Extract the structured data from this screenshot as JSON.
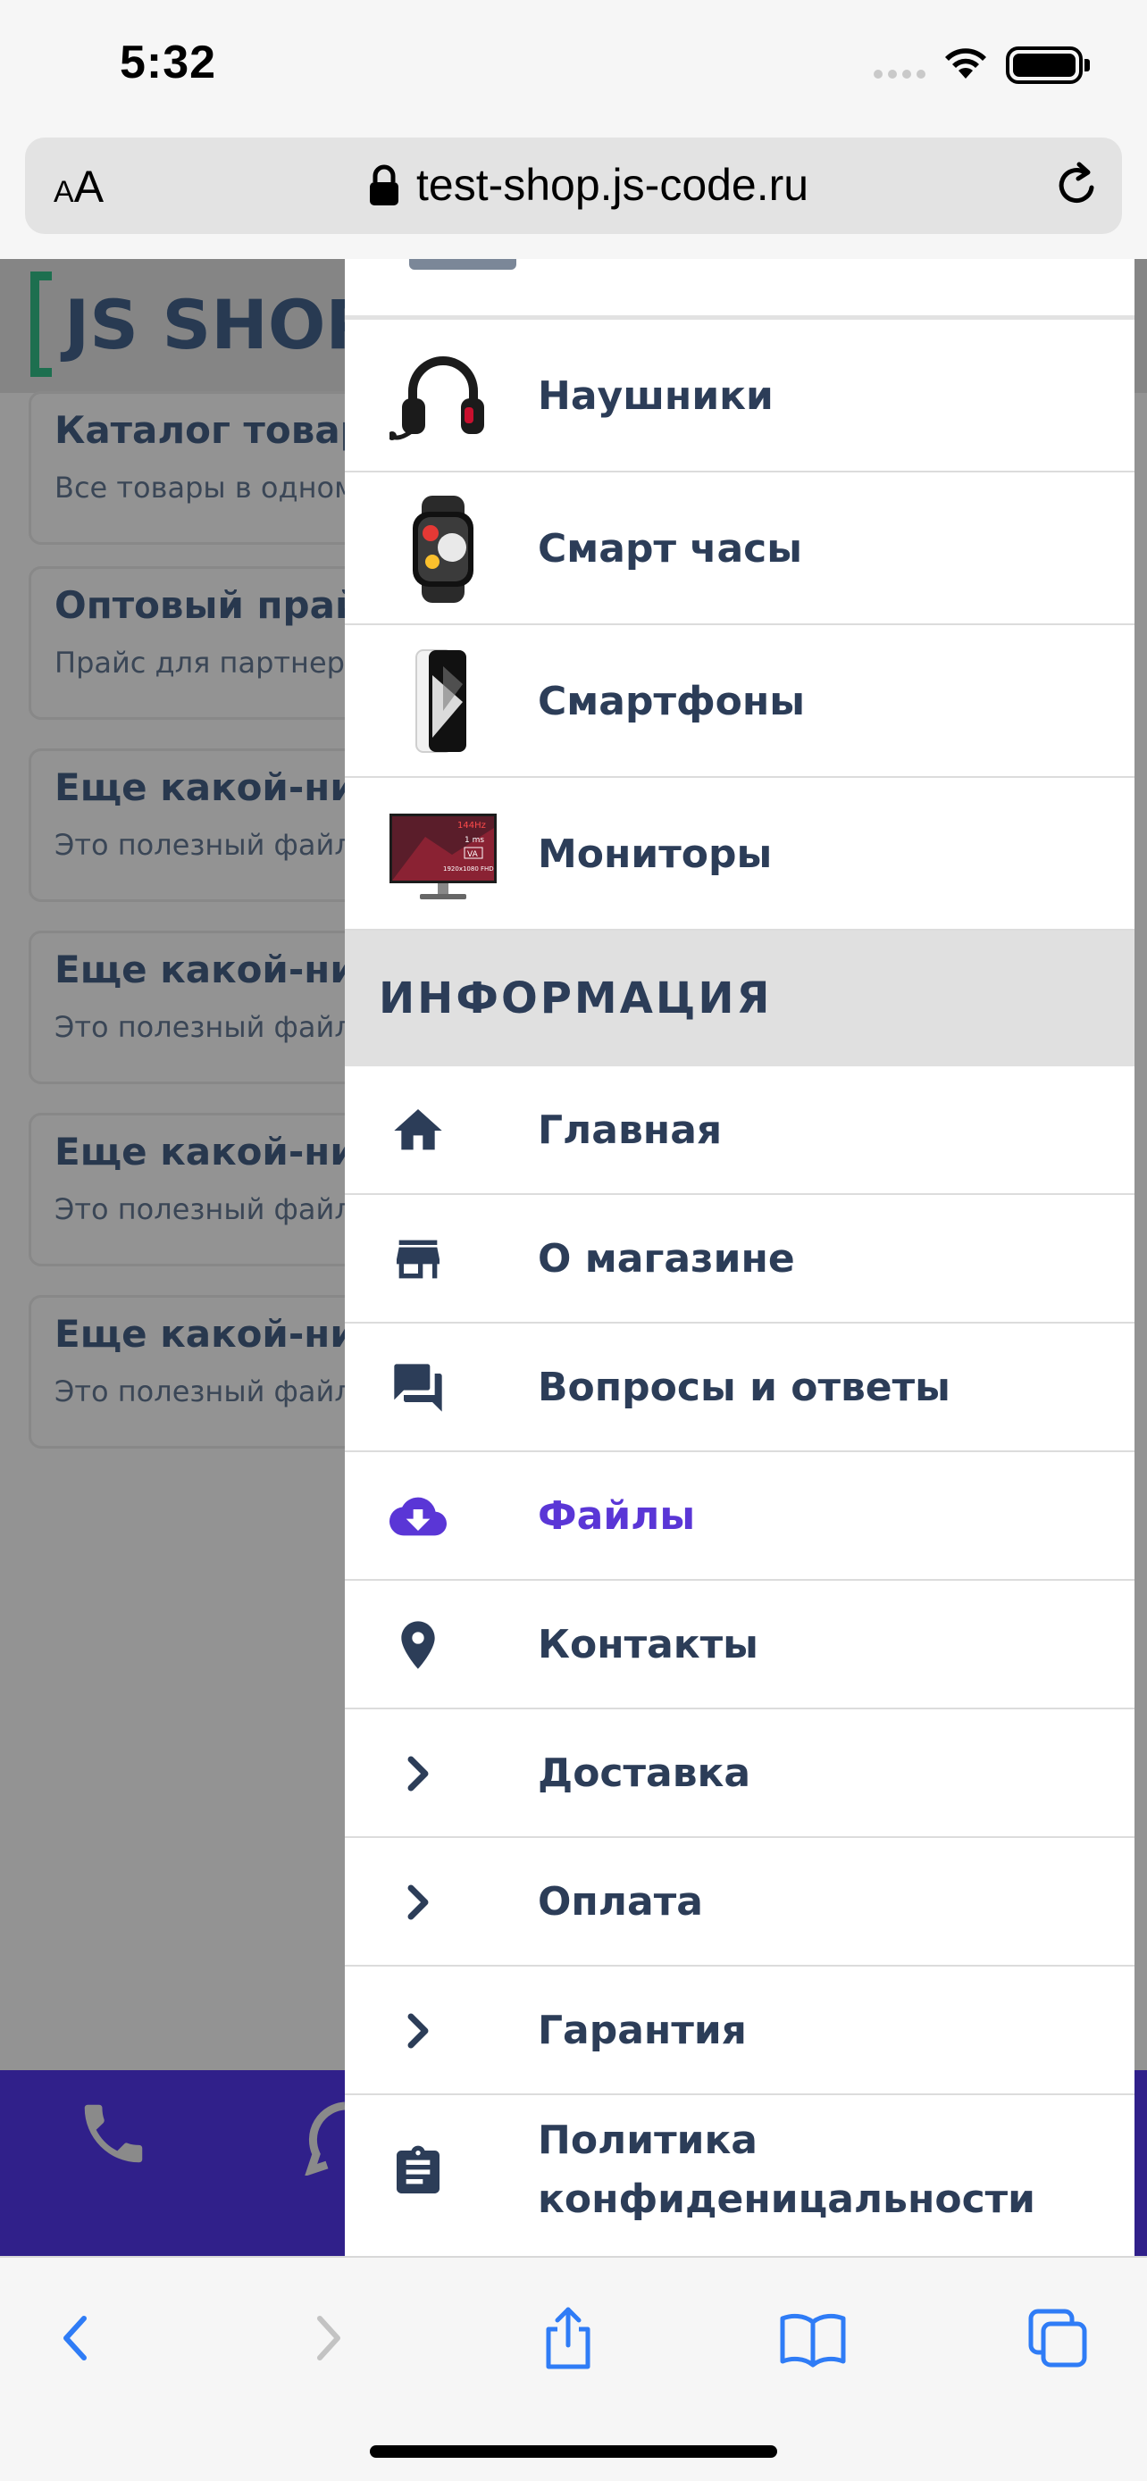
{
  "status_bar": {
    "time": "5:32"
  },
  "browser": {
    "text_size_label_small": "A",
    "text_size_label_large": "A",
    "url": "test-shop.js-code.ru"
  },
  "background_page": {
    "logo_text": "JS SHOP",
    "cards": [
      {
        "title": "Каталог товаро",
        "subtitle": "Все товары в одном"
      },
      {
        "title": "Оптовый прай",
        "subtitle": "Прайс для партнеро"
      },
      {
        "title": "Еще какой-ниб",
        "subtitle": "Это полезный файл"
      },
      {
        "title": "Еще какой-ниб",
        "subtitle": "Это полезный файл"
      },
      {
        "title": "Еще какой-ниб",
        "subtitle": "Это полезный файл"
      },
      {
        "title": "Еще какой-ниб",
        "subtitle": "Это полезный файл"
      }
    ]
  },
  "menu": {
    "categories": [
      {
        "label": "Наушники",
        "icon": "headphones-thumb"
      },
      {
        "label": "Смарт часы",
        "icon": "smartwatch-thumb"
      },
      {
        "label": "Смартфоны",
        "icon": "smartphone-thumb"
      },
      {
        "label": "Мониторы",
        "icon": "monitor-thumb"
      }
    ],
    "monitor_thumb_text": {
      "hz": "144Hz",
      "ms": "1 ms",
      "panel": "VA",
      "res": "1920x1080 FHD"
    },
    "info_title": "ИНФОРМАЦИЯ",
    "info_items": [
      {
        "label": "Главная",
        "icon": "home-icon"
      },
      {
        "label": "О магазине",
        "icon": "store-icon"
      },
      {
        "label": "Вопросы и ответы",
        "icon": "chat-icon"
      },
      {
        "label": "Файлы",
        "icon": "cloud-download-icon",
        "active": true
      },
      {
        "label": "Контакты",
        "icon": "map-pin-icon"
      },
      {
        "label": "Доставка",
        "icon": "chevron-right-icon"
      },
      {
        "label": "Оплата",
        "icon": "chevron-right-icon"
      },
      {
        "label": "Гарантия",
        "icon": "chevron-right-icon"
      }
    ],
    "policy_label": "Политика конфиденицальности"
  },
  "colors": {
    "menu_text": "#2c3d58",
    "active": "#5a36d6",
    "bottom_bar": "#30208a",
    "ios_blue": "#2f7cf6"
  }
}
